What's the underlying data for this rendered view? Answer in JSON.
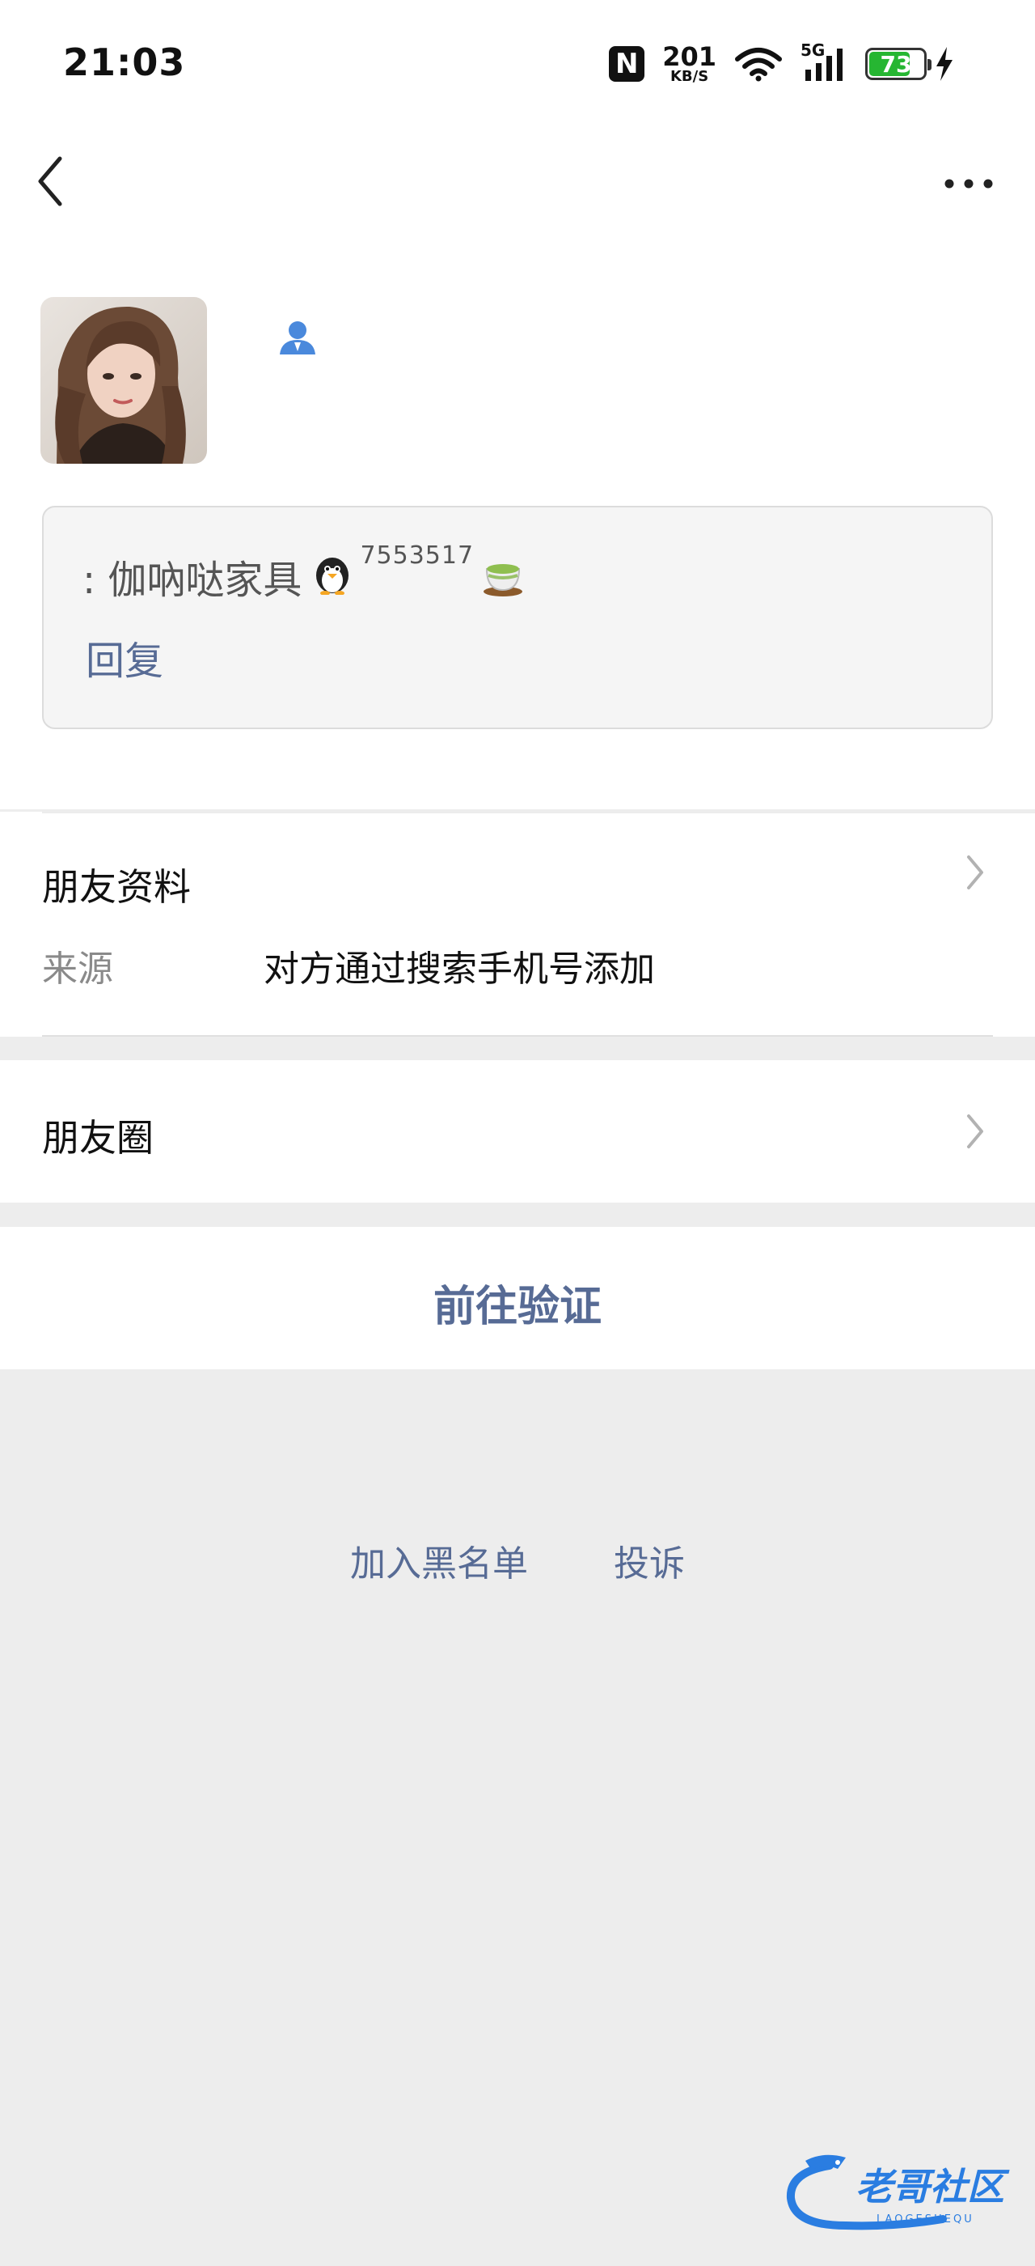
{
  "status_bar": {
    "time": "21:03",
    "nfc": "N",
    "net_speed": "201",
    "net_unit": "KB/S",
    "network": "5G",
    "battery": "73"
  },
  "nav": {
    "back_icon": "chevron-left-icon",
    "more_icon": "more-dots-icon"
  },
  "profile": {
    "contact_icon": "contact-person-icon"
  },
  "message": {
    "prefix": ": 伽吶哒家具",
    "emoji1": "penguin",
    "number": "7553517",
    "emoji2": "tea-cup",
    "reply_label": "回复"
  },
  "friend_info": {
    "title": "朋友资料",
    "source_label": "来源",
    "source_value": "对方通过搜索手机号添加"
  },
  "moments": {
    "title": "朋友圈"
  },
  "action": {
    "verify_label": "前往验证"
  },
  "footer": {
    "blacklist_label": "加入黑名单",
    "report_label": "投诉"
  },
  "watermark": {
    "text": "老哥社区",
    "subtext": "LAOGESHEQU"
  },
  "colors": {
    "link": "#576b95",
    "background": "#ededed",
    "battery": "#26b632"
  }
}
